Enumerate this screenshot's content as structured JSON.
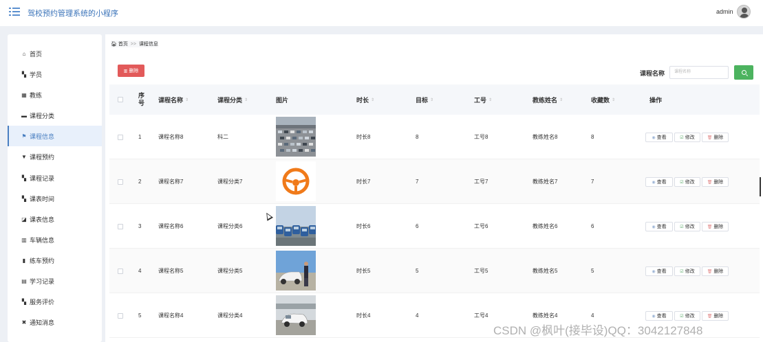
{
  "app": {
    "title": "驾校预约管理系统的小程序",
    "user": "admin"
  },
  "sidebar": {
    "items": [
      {
        "label": "首页",
        "icon": "home-icon",
        "glyph": "⌂"
      },
      {
        "label": "学员",
        "icon": "grid-icon",
        "glyph": "▚"
      },
      {
        "label": "教练",
        "icon": "grid-icon",
        "glyph": "▦"
      },
      {
        "label": "课程分类",
        "icon": "briefcase-icon",
        "glyph": "▬"
      },
      {
        "label": "课程信息",
        "icon": "flag-icon",
        "glyph": "⚑",
        "active": true
      },
      {
        "label": "课程预约",
        "icon": "filter-icon",
        "glyph": "▼"
      },
      {
        "label": "课程记录",
        "icon": "grid-icon",
        "glyph": "▚"
      },
      {
        "label": "课表时间",
        "icon": "grid-icon",
        "glyph": "▚"
      },
      {
        "label": "课表信息",
        "icon": "check-square-icon",
        "glyph": "◪"
      },
      {
        "label": "车辆信息",
        "icon": "library-icon",
        "glyph": "▥"
      },
      {
        "label": "练车预约",
        "icon": "bar-chart-icon",
        "glyph": "▮"
      },
      {
        "label": "学习记录",
        "icon": "book-icon",
        "glyph": "▤"
      },
      {
        "label": "服务评价",
        "icon": "grid-icon",
        "glyph": "▚"
      },
      {
        "label": "通知消息",
        "icon": "bookmark-icon",
        "glyph": "✖"
      }
    ]
  },
  "breadcrumb": {
    "home": "首页",
    "sep": ">>",
    "current": "课程信息"
  },
  "toolbar": {
    "delete_label": "删除",
    "search_label": "课程名称",
    "search_placeholder": "课程名称"
  },
  "table": {
    "columns": [
      {
        "key": "seq",
        "label": "序号",
        "sortable": false
      },
      {
        "key": "name",
        "label": "课程名称",
        "sortable": true
      },
      {
        "key": "category",
        "label": "课程分类",
        "sortable": true
      },
      {
        "key": "image",
        "label": "图片",
        "sortable": false
      },
      {
        "key": "duration",
        "label": "时长",
        "sortable": true
      },
      {
        "key": "goal",
        "label": "目标",
        "sortable": true
      },
      {
        "key": "staff_id",
        "label": "工号",
        "sortable": true
      },
      {
        "key": "coach",
        "label": "教练姓名",
        "sortable": true
      },
      {
        "key": "favorites",
        "label": "收藏数",
        "sortable": true
      },
      {
        "key": "ops",
        "label": "操作",
        "sortable": false
      }
    ],
    "rows": [
      {
        "seq": "1",
        "name": "课程名称8",
        "category": "科二",
        "image": "parking-lot-photo",
        "duration": "时长8",
        "goal": "8",
        "staff_id": "工号8",
        "coach": "教练姓名8",
        "favorites": "8"
      },
      {
        "seq": "2",
        "name": "课程名称7",
        "category": "课程分类7",
        "image": "steering-wheel-photo",
        "duration": "时长7",
        "goal": "7",
        "staff_id": "工号7",
        "coach": "教练姓名7",
        "favorites": "7"
      },
      {
        "seq": "3",
        "name": "课程名称6",
        "category": "课程分类6",
        "image": "car-row-photo",
        "duration": "时长6",
        "goal": "6",
        "staff_id": "工号6",
        "coach": "教练姓名6",
        "favorites": "6"
      },
      {
        "seq": "4",
        "name": "课程名称5",
        "category": "课程分类5",
        "image": "car-instructor-photo",
        "duration": "时长5",
        "goal": "5",
        "staff_id": "工号5",
        "coach": "教练姓名5",
        "favorites": "5"
      },
      {
        "seq": "5",
        "name": "课程名称4",
        "category": "课程分类4",
        "image": "training-car-photo",
        "duration": "时长4",
        "goal": "4",
        "staff_id": "工号4",
        "coach": "教练姓名4",
        "favorites": "4"
      }
    ],
    "actions": {
      "view": "查看",
      "edit": "修改",
      "delete": "删除"
    }
  },
  "watermark": "CSDN @枫叶(接毕设)QQ：3042127848",
  "colors": {
    "accent": "#4a7fc1",
    "danger": "#e25a5a",
    "search": "#4cb35f",
    "background": "#edf0f5"
  }
}
